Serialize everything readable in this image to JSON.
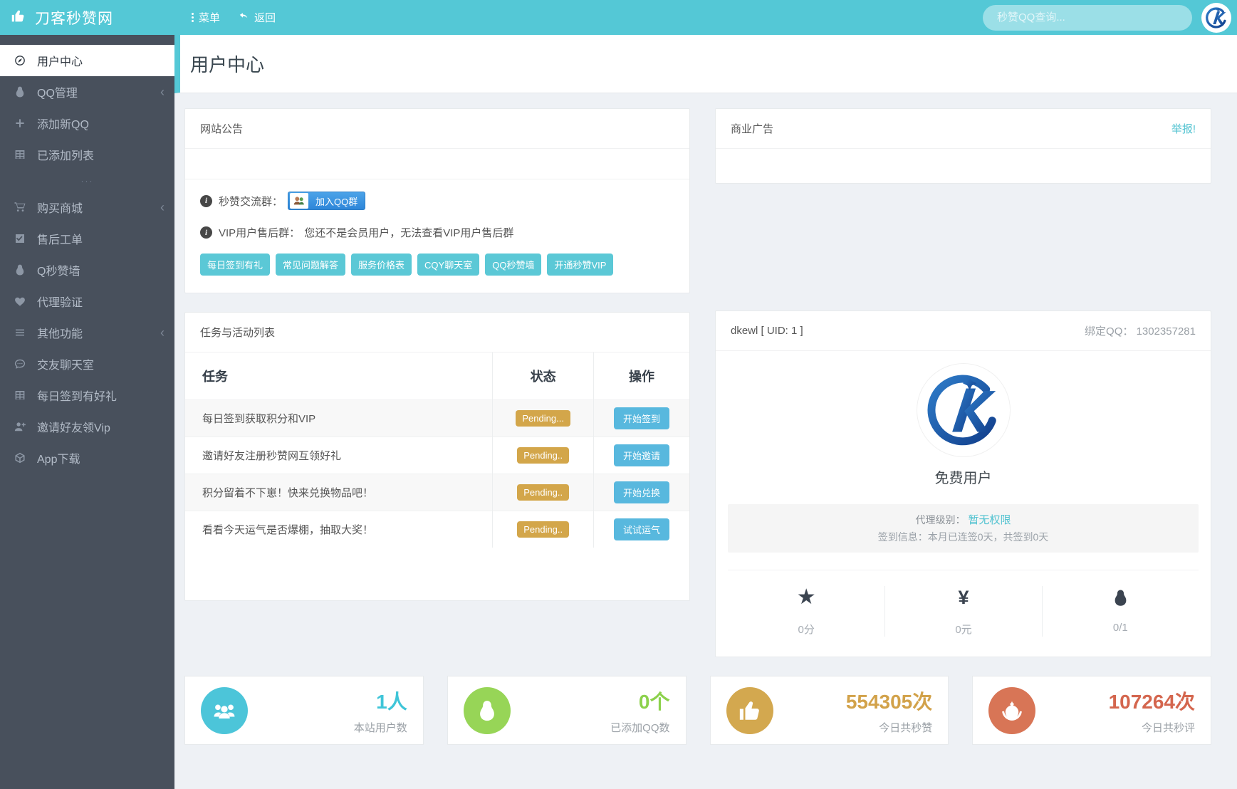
{
  "navbar": {
    "brand": "刀客秒赞网",
    "menu_label": "菜单",
    "back_label": "返回",
    "search_placeholder": "秒赞QQ查询..."
  },
  "page": {
    "title": "用户中心"
  },
  "sidebar": {
    "items": [
      {
        "label": "用户中心",
        "icon": "compass",
        "active": true
      },
      {
        "label": "QQ管理",
        "icon": "qq",
        "submenu": true
      },
      {
        "label": "添加新QQ",
        "icon": "plus"
      },
      {
        "label": "已添加列表",
        "icon": "table"
      },
      {
        "divider": true,
        "label": "···"
      },
      {
        "label": "购买商城",
        "icon": "cart",
        "submenu": true
      },
      {
        "label": "售后工单",
        "icon": "check"
      },
      {
        "label": "Q秒赞墙",
        "icon": "qq"
      },
      {
        "label": "代理验证",
        "icon": "heart"
      },
      {
        "label": "其他功能",
        "icon": "list",
        "submenu": true
      },
      {
        "label": "交友聊天室",
        "icon": "comment"
      },
      {
        "label": "每日签到有好礼",
        "icon": "table"
      },
      {
        "label": "邀请好友领Vip",
        "icon": "userplus"
      },
      {
        "label": "App下载",
        "icon": "box"
      }
    ]
  },
  "announcement_card": {
    "title": "网站公告",
    "group_row": {
      "label": "秒赞交流群：",
      "join_button": "加入QQ群"
    },
    "vip_row": {
      "label": "VIP用户售后群：",
      "text": "您还不是会员用户，无法查看VIP用户售后群"
    },
    "quick_links": [
      "每日签到有礼",
      "常见问题解答",
      "服务价格表",
      "CQY聊天室",
      "QQ秒赞墙",
      "开通秒赞VIP"
    ]
  },
  "ad_card": {
    "title": "商业广告",
    "report_link": "举报!"
  },
  "task_card": {
    "title": "任务与活动列表",
    "columns": [
      "任务",
      "状态",
      "操作"
    ],
    "rows": [
      {
        "task": "每日签到获取积分和VIP",
        "status": "Pending...",
        "action": "开始签到"
      },
      {
        "task": "邀请好友注册秒赞网互领好礼",
        "status": "Pending..",
        "action": "开始邀请"
      },
      {
        "task": "积分留着不下崽！快来兑换物品吧！",
        "status": "Pending..",
        "action": "开始兑换"
      },
      {
        "task": "看看今天运气是否爆棚，抽取大奖！",
        "status": "Pending..",
        "action": "试试运气"
      }
    ]
  },
  "profile_card": {
    "username": "dkewl [ UID: 1 ]",
    "bind_qq_label": "绑定QQ：",
    "bind_qq_value": "1302357281",
    "user_type": "免费用户",
    "agent_label": "代理级别：",
    "agent_value": "暂无权限",
    "signin_text": "签到信息：本月已连签0天，共签到0天",
    "stats": [
      {
        "icon": "star",
        "value": "0分"
      },
      {
        "icon": "yen",
        "value": "0元"
      },
      {
        "icon": "qq",
        "value": "0/1"
      }
    ]
  },
  "summary_cards": [
    {
      "icon": "users",
      "value": "1人",
      "label": "本站用户数",
      "accent": "#3fc5d8",
      "circle": "#4cc5d9"
    },
    {
      "icon": "qq",
      "value": "0个",
      "label": "已添加QQ数",
      "accent": "#8cd14c",
      "circle": "#97d557"
    },
    {
      "icon": "thumbs",
      "value": "554305次",
      "label": "今日共秒赞",
      "accent": "#d2a24a",
      "circle": "#d3a84f"
    },
    {
      "icon": "rebel",
      "value": "107264次",
      "label": "今日共秒评",
      "accent": "#d4664e",
      "circle": "#d87556"
    }
  ],
  "colors": {
    "theme_teal": "#54c8d6",
    "sidebar_bg": "#48505c",
    "link_teal": "#53c3d1",
    "badge_gold": "#d3a64a",
    "action_blue": "#58b8de",
    "quicklink_teal": "#5bc8d6"
  }
}
